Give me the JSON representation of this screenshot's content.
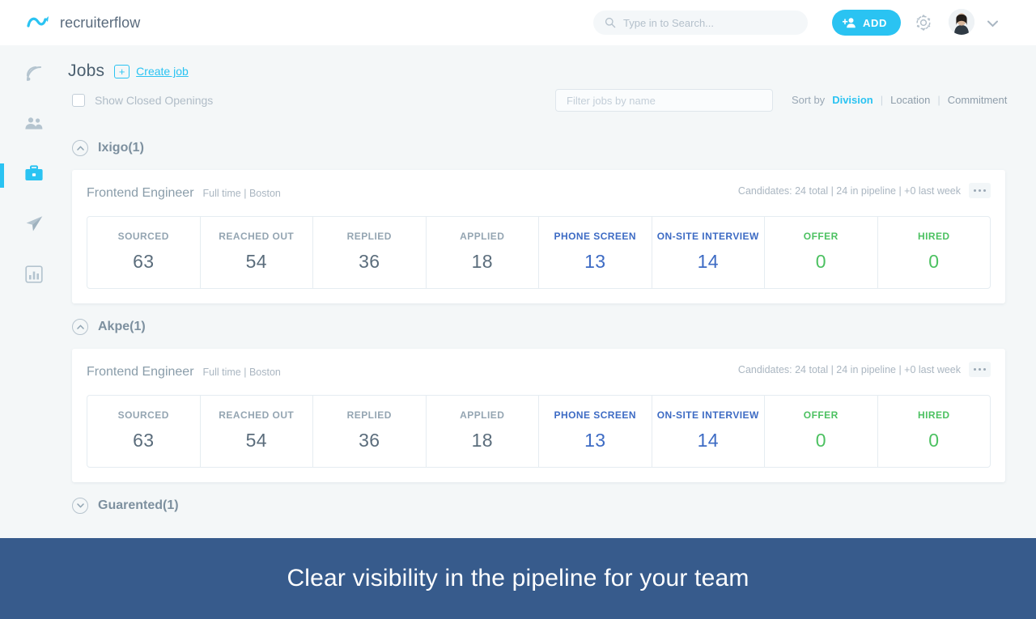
{
  "brand": {
    "name": "recruiterflow",
    "logo_icon": "recruiterflow-wave-logo"
  },
  "topbar": {
    "search": {
      "placeholder": "Type in to Search...",
      "value": "",
      "icon": "search-icon"
    },
    "add_button": {
      "label": "ADD",
      "icon": "add-person-icon",
      "color": "#2ac3f2"
    },
    "settings_icon": "gear-icon",
    "avatar_icon": "user-avatar",
    "caret_icon": "chevron-down-icon"
  },
  "sidebar": {
    "items": [
      {
        "name": "feed",
        "icon": "rss-feed-icon",
        "active": false
      },
      {
        "name": "contacts",
        "icon": "people-icon",
        "active": false
      },
      {
        "name": "jobs",
        "icon": "briefcase-icon",
        "active": true
      },
      {
        "name": "campaigns",
        "icon": "paper-plane-icon",
        "active": false
      },
      {
        "name": "reports",
        "icon": "bar-chart-icon",
        "active": false
      }
    ],
    "active_color": "#2ac3f2"
  },
  "page": {
    "title": "Jobs",
    "create_job_label": "Create job",
    "create_job_plus": "+",
    "show_closed_label": "Show Closed Openings",
    "show_closed_checked": false,
    "filter_placeholder": "Filter jobs by name",
    "filter_value": ""
  },
  "sort": {
    "label": "Sort by",
    "options": [
      {
        "label": "Division",
        "selected": true
      },
      {
        "label": "Location",
        "selected": false
      },
      {
        "label": "Commitment",
        "selected": false
      }
    ],
    "separator": "|",
    "selected_color": "#2ac3f2"
  },
  "groups": [
    {
      "title": "Ixigo(1)",
      "expanded": true,
      "chevron": "chevron-up-icon",
      "jobs": [
        {
          "title": "Frontend Engineer",
          "meta": "Full time | Boston",
          "candidates": "Candidates: 24 total | 24 in pipeline | +0 last week",
          "menu_icon": "more-options-icon",
          "stages": [
            {
              "name": "SOURCED",
              "value": "63",
              "tone": "neutral"
            },
            {
              "name": "REACHED OUT",
              "value": "54",
              "tone": "neutral"
            },
            {
              "name": "REPLIED",
              "value": "36",
              "tone": "neutral"
            },
            {
              "name": "APPLIED",
              "value": "18",
              "tone": "neutral"
            },
            {
              "name": "PHONE SCREEN",
              "value": "13",
              "tone": "blue"
            },
            {
              "name": "ON-SITE INTERVIEW",
              "value": "14",
              "tone": "blue"
            },
            {
              "name": "OFFER",
              "value": "0",
              "tone": "green"
            },
            {
              "name": "HIRED",
              "value": "0",
              "tone": "green"
            }
          ]
        }
      ]
    },
    {
      "title": "Akpe(1)",
      "expanded": true,
      "chevron": "chevron-up-icon",
      "jobs": [
        {
          "title": "Frontend Engineer",
          "meta": "Full time | Boston",
          "candidates": "Candidates: 24 total | 24 in pipeline | +0 last week",
          "menu_icon": "more-options-icon",
          "stages": [
            {
              "name": "SOURCED",
              "value": "63",
              "tone": "neutral"
            },
            {
              "name": "REACHED OUT",
              "value": "54",
              "tone": "neutral"
            },
            {
              "name": "REPLIED",
              "value": "36",
              "tone": "neutral"
            },
            {
              "name": "APPLIED",
              "value": "18",
              "tone": "neutral"
            },
            {
              "name": "PHONE SCREEN",
              "value": "13",
              "tone": "blue"
            },
            {
              "name": "ON-SITE INTERVIEW",
              "value": "14",
              "tone": "blue"
            },
            {
              "name": "OFFER",
              "value": "0",
              "tone": "green"
            },
            {
              "name": "HIRED",
              "value": "0",
              "tone": "green"
            }
          ]
        }
      ]
    },
    {
      "title": "Guarented(1)",
      "expanded": false,
      "chevron": "chevron-down-icon",
      "jobs": []
    }
  ],
  "banner": {
    "text": "Clear visibility in the pipeline for your team",
    "bg": "#375b8c"
  },
  "colors": {
    "stage_blue": "#3d6bc4",
    "stage_green": "#4cc161",
    "accent": "#2ac3f2"
  }
}
